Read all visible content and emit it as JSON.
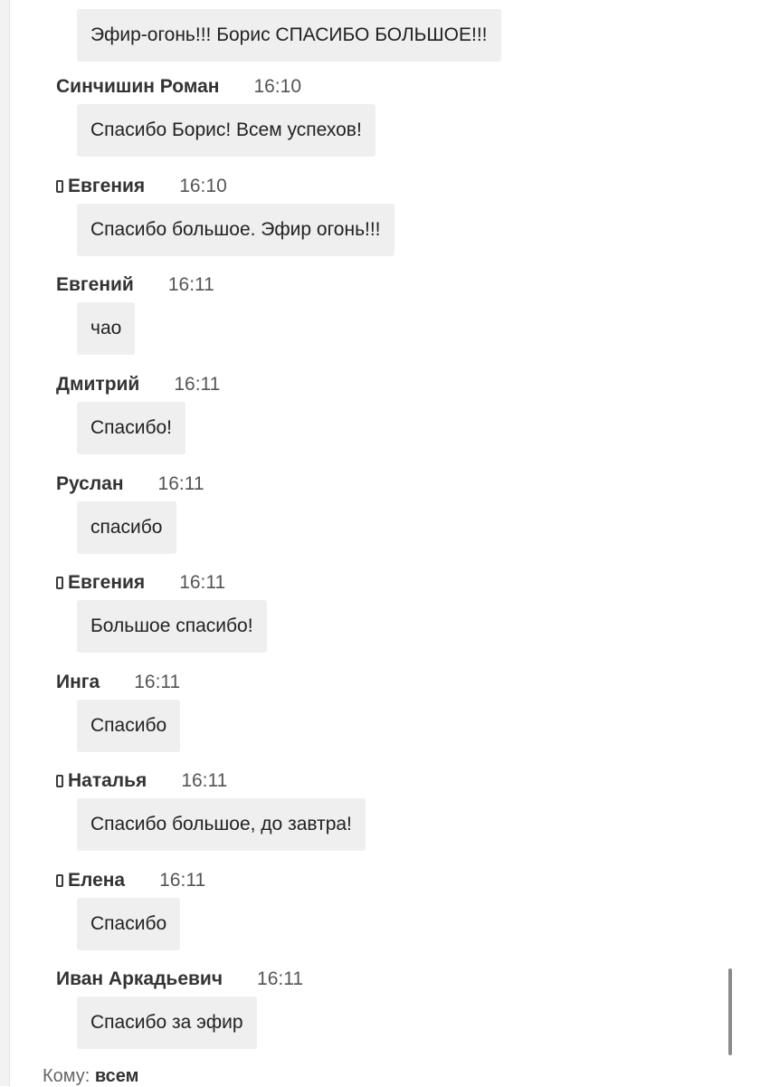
{
  "top_message": {
    "text": "Эфир-огонь!!! Борис СПАСИБО БОЛЬШОЕ!!!"
  },
  "messages": [
    {
      "sender": "Синчишин Роман",
      "time": "16:10",
      "text": "Спасибо Борис! Всем успехов!",
      "mobile": false
    },
    {
      "sender": "Евгения",
      "time": "16:10",
      "text": "Спасибо большое. Эфир огонь!!!",
      "mobile": true
    },
    {
      "sender": "Евгений",
      "time": "16:11",
      "text": "чао",
      "mobile": false
    },
    {
      "sender": "Дмитрий",
      "time": "16:11",
      "text": "Спасибо!",
      "mobile": false
    },
    {
      "sender": "Руслан",
      "time": "16:11",
      "text": "спасибо",
      "mobile": false
    },
    {
      "sender": "Евгения",
      "time": "16:11",
      "text": "Большое спасибо!",
      "mobile": true
    },
    {
      "sender": "Инга",
      "time": "16:11",
      "text": "Спасибо",
      "mobile": false
    },
    {
      "sender": "Наталья",
      "time": "16:11",
      "text": "Спасибо большое, до завтра!",
      "mobile": true
    },
    {
      "sender": "Елена",
      "time": "16:11",
      "text": "Спасибо",
      "mobile": true
    },
    {
      "sender": "Иван Аркадьевич",
      "time": "16:11",
      "text": "Спасибо за эфир",
      "mobile": false
    }
  ],
  "recipient": {
    "label": "Кому:",
    "value": "всем"
  }
}
